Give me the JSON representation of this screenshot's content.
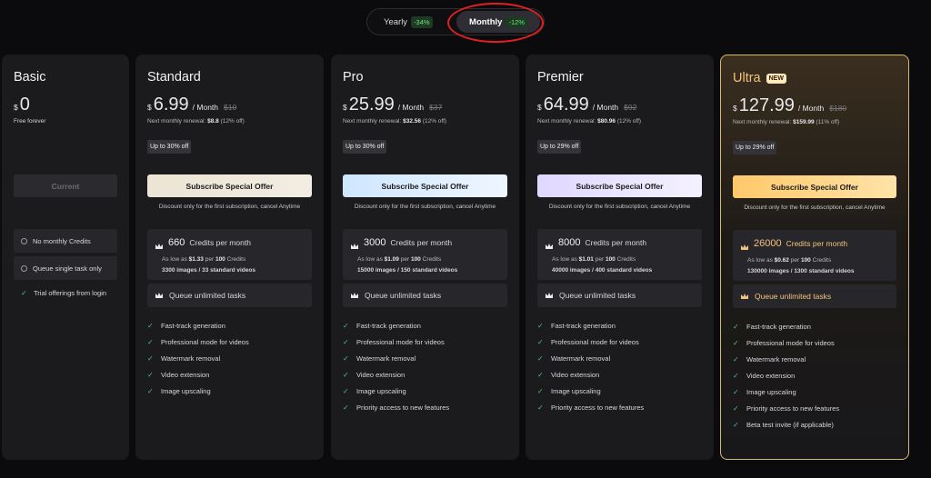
{
  "toggle": {
    "yearly_label": "Yearly",
    "yearly_discount": "-34%",
    "monthly_label": "Monthly",
    "monthly_discount": "-12%",
    "selected": "Monthly"
  },
  "colors": {
    "background": "#0b0b0d",
    "card": "#1b1b1e",
    "check": "#48c774",
    "ultra_border": "#d8b878",
    "ultra_accent": "#f4c37a",
    "annotation": "#e02020"
  },
  "basic": {
    "name": "Basic",
    "currency": "$",
    "price": "0",
    "subtitle": "Free forever",
    "button": "Current",
    "items": [
      "No monthly Credits",
      "Queue single task only"
    ],
    "trial": "Trial offerings from login"
  },
  "plans": [
    {
      "name": "Standard",
      "currency": "$",
      "price": "6.99",
      "per": "/ Month",
      "old_price": "$10",
      "renewal_prefix": "Next monthly renewal:",
      "renewal_value": "$8.8",
      "renewal_suffix": "(12% off)",
      "up_to": "Up to 30% off",
      "button": "Subscribe Special Offer",
      "discount_note": "Discount only for the first subscription, cancel Anytime",
      "credits_num": "660",
      "credits_label": "Credits per month",
      "as_low_prefix": "As low as",
      "as_low_price": "$1.33",
      "as_low_per": "per",
      "as_low_count": "100",
      "as_low_unit": "Credits",
      "images_line": "3300 images / 33 standard videos",
      "queue": "Queue unlimited tasks",
      "features": [
        "Fast-track generation",
        "Professional mode for videos",
        "Watermark removal",
        "Video extension",
        "Image upscaling"
      ]
    },
    {
      "name": "Pro",
      "currency": "$",
      "price": "25.99",
      "per": "/ Month",
      "old_price": "$37",
      "renewal_prefix": "Next monthly renewal:",
      "renewal_value": "$32.56",
      "renewal_suffix": "(12% off)",
      "up_to": "Up to 30% off",
      "button": "Subscribe Special Offer",
      "discount_note": "Discount only for the first subscription, cancel Anytime",
      "credits_num": "3000",
      "credits_label": "Credits per month",
      "as_low_prefix": "As low as",
      "as_low_price": "$1.09",
      "as_low_per": "per",
      "as_low_count": "100",
      "as_low_unit": "Credits",
      "images_line": "15000 images / 150 standard videos",
      "queue": "Queue unlimited tasks",
      "features": [
        "Fast-track generation",
        "Professional mode for videos",
        "Watermark removal",
        "Video extension",
        "Image upscaling",
        "Priority access to new features"
      ]
    },
    {
      "name": "Premier",
      "currency": "$",
      "price": "64.99",
      "per": "/ Month",
      "old_price": "$92",
      "renewal_prefix": "Next monthly renewal:",
      "renewal_value": "$80.96",
      "renewal_suffix": "(12% off)",
      "up_to": "Up to 29% off",
      "button": "Subscribe Special Offer",
      "discount_note": "Discount only for the first subscription, cancel Anytime",
      "credits_num": "8000",
      "credits_label": "Credits per month",
      "as_low_prefix": "As low as",
      "as_low_price": "$1.01",
      "as_low_per": "per",
      "as_low_count": "100",
      "as_low_unit": "Credits",
      "images_line": "40000 images / 400 standard videos",
      "queue": "Queue unlimited tasks",
      "features": [
        "Fast-track generation",
        "Professional mode for videos",
        "Watermark removal",
        "Video extension",
        "Image upscaling",
        "Priority access to new features"
      ]
    },
    {
      "name": "Ultra",
      "badge": "NEW",
      "currency": "$",
      "price": "127.99",
      "per": "/ Month",
      "old_price": "$180",
      "renewal_prefix": "Next monthly renewal:",
      "renewal_value": "$159.99",
      "renewal_suffix": "(11% off)",
      "up_to": "Up to 29% off",
      "button": "Subscribe Special Offer",
      "discount_note": "Discount only for the first subscription, cancel Anytime",
      "credits_num": "26000",
      "credits_label": "Credits per month",
      "as_low_prefix": "As low as",
      "as_low_price": "$0.62",
      "as_low_per": "per",
      "as_low_count": "100",
      "as_low_unit": "Credits",
      "images_line": "130000 images / 1300 standard videos",
      "queue": "Queue unlimited tasks",
      "features": [
        "Fast-track generation",
        "Professional mode for videos",
        "Watermark removal",
        "Video extension",
        "Image upscaling",
        "Priority access to new features",
        "Beta test invite (if applicable)"
      ]
    }
  ]
}
